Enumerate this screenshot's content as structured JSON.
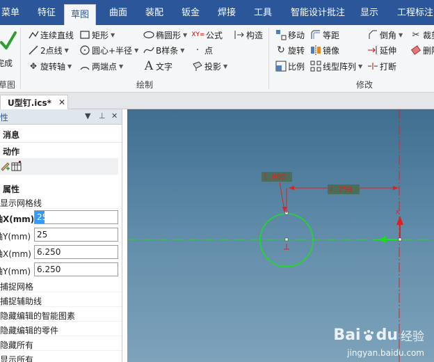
{
  "menu": {
    "tabs": [
      {
        "label": "菜单",
        "active": false
      },
      {
        "label": "特征",
        "active": false
      },
      {
        "label": "草图",
        "active": true
      },
      {
        "label": "曲面",
        "active": false
      },
      {
        "label": "装配",
        "active": false
      },
      {
        "label": "钣金",
        "active": false
      },
      {
        "label": "焊接",
        "active": false
      },
      {
        "label": "工具",
        "active": false
      },
      {
        "label": "智能设计批注",
        "active": false
      },
      {
        "label": "显示",
        "active": false
      },
      {
        "label": "工程标注",
        "active": false
      }
    ]
  },
  "ribbon": {
    "finish": {
      "label": "完成",
      "group": "草图"
    },
    "draw": {
      "group": "绘制",
      "polyline": "连续直线",
      "rectangle": "矩形",
      "ellipse": "椭圆形",
      "formula": "公式",
      "construct": "构造",
      "two_point_line": "2点线",
      "center_radius": "圆心+半径",
      "bspline": "B样条",
      "point": "点",
      "rotate_axis": "旋转轴",
      "two_endpoints": "两端点",
      "text": "文字",
      "project": "投影"
    },
    "modify": {
      "group": "修改",
      "move": "移动",
      "equidistant": "等距",
      "chamfer": "倒角",
      "trim": "裁剪",
      "rotate": "旋转",
      "mirror": "镜像",
      "extend": "延伸",
      "delete": "删除",
      "scale": "比例",
      "linear_array": "线型阵列",
      "break": "打断"
    }
  },
  "document": {
    "tab_name": "U型钉.ics*"
  },
  "panel": {
    "title": "性",
    "sections": {
      "message": "消息",
      "action": "动作",
      "properties": "属性"
    },
    "show_grid": "显示网格线",
    "fields": [
      {
        "label": "轴X(mm)",
        "value": "25",
        "selected": true
      },
      {
        "label": "轴Y(mm)",
        "value": "25",
        "selected": false
      },
      {
        "label": "轴X(mm)",
        "value": "6.250",
        "selected": false
      },
      {
        "label": "轴Y(mm)",
        "value": "6.250",
        "selected": false
      }
    ],
    "checks": [
      "捕捉网格",
      "捕捉辅助线",
      "隐藏编辑的智能图素",
      "隐藏编辑的零件",
      "隐藏所有",
      "显示所有"
    ]
  },
  "canvas": {
    "dimension_radius": "1.000",
    "dimension_distance": "4.250",
    "colors": {
      "background": "#5e8aa8",
      "circle": "#19e019",
      "center_line": "#19e019",
      "dimension": "#e02020",
      "label_box": "#4a6e5a"
    }
  },
  "watermark": {
    "brand": "Bai",
    "brand2": "du",
    "text": "经验",
    "url": "jingyan.baidu.com"
  }
}
